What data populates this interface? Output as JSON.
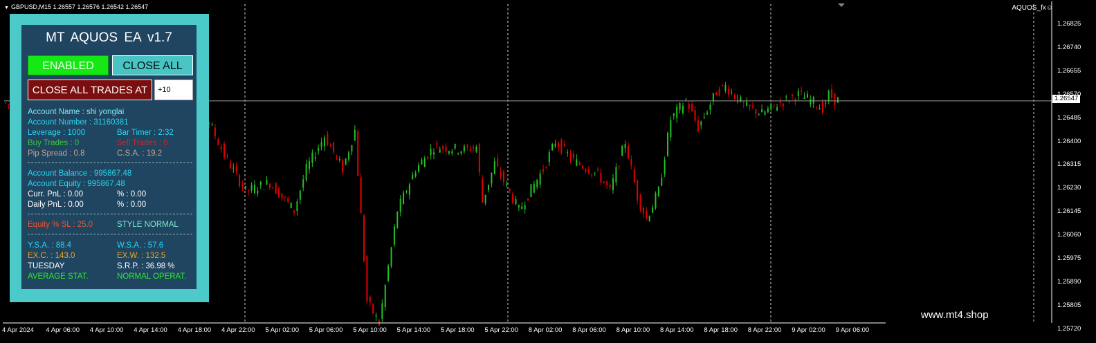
{
  "chart": {
    "symbol_header": "GBPUSD,M15  1.26557 1.26576 1.26542 1.26547",
    "indicator_label": "AQUOS_fx☺",
    "watermark": "www.mt4.shop",
    "current_price": "1.26547",
    "colors": {
      "bull": "#22c322",
      "bear": "#e60000",
      "grid": "#cfcfcf",
      "bid_line": "#9a9a9a"
    }
  },
  "axis": {
    "x_labels": [
      "4 Apr 2024",
      "4 Apr 06:00",
      "4 Apr 10:00",
      "4 Apr 14:00",
      "4 Apr 18:00",
      "4 Apr 22:00",
      "5 Apr 02:00",
      "5 Apr 06:00",
      "5 Apr 10:00",
      "5 Apr 14:00",
      "5 Apr 18:00",
      "5 Apr 22:00",
      "8 Apr 02:00",
      "8 Apr 06:00",
      "8 Apr 10:00",
      "8 Apr 14:00",
      "8 Apr 18:00",
      "8 Apr 22:00",
      "9 Apr 02:00",
      "9 Apr 06:00"
    ],
    "y_labels": [
      "1.26825",
      "1.26740",
      "1.26655",
      "1.26570",
      "1.26485",
      "1.26400",
      "1.26315",
      "1.26230",
      "1.26145",
      "1.26060",
      "1.25975",
      "1.25890",
      "1.25805",
      "1.25720"
    ]
  },
  "ea": {
    "title": "MT  AQUOS EA  v1.7",
    "enabled_label": "ENABLED",
    "close_all_label": "CLOSE ALL",
    "close_trades_at_label": "CLOSE ALL TRADES AT",
    "close_trades_value": "+10",
    "account_name": "Account Name : shi yonglai",
    "account_number": "Account Number : 31160381",
    "leverage": "Leverage : 1000",
    "bar_timer": "Bar Timer : 2:32",
    "buy_trades": "Buy Trades : 0",
    "sell_trades": "Sell Trades : 0",
    "pip_spread": "Pip Spread : 0.8",
    "csa": "C.S.A. : 19.2",
    "balance": "Account Balance : 995867.48",
    "equity": "Account Equity : 995867.48",
    "curr_pnl": "Curr. PnL : 0.00",
    "curr_pct": "% : 0.00",
    "daily_pnl": "Daily PnL : 0.00",
    "daily_pct": "% : 0.00",
    "equity_sl": "Equity % SL : 25.0",
    "style": "STYLE NORMAL",
    "ysa": "Y.S.A. : 88.4",
    "wsa": "W.S.A. : 57.6",
    "exc": "EX.C. : 143.0",
    "exw": "EX.W. : 132.5",
    "day": "TUESDAY",
    "srp": "S.R.P. : 36.98 %",
    "avg_stat": "AVERAGE STAT.",
    "normal_operat": "NORMAL OPERAT."
  },
  "chart_data": {
    "type": "candlestick",
    "symbol": "GBPUSD",
    "timeframe": "M15",
    "ylim": [
      1.2572,
      1.2688
    ],
    "bid": 1.26547,
    "anchors": [
      [
        0,
        1.2654
      ],
      [
        5,
        1.2652
      ],
      [
        30,
        1.2652
      ],
      [
        33,
        1.266
      ],
      [
        45,
        1.265
      ],
      [
        52,
        1.264
      ],
      [
        58,
        1.2645
      ],
      [
        63,
        1.265
      ],
      [
        68,
        1.2647
      ],
      [
        73,
        1.2635
      ],
      [
        80,
        1.2622
      ],
      [
        88,
        1.2625
      ],
      [
        96,
        1.2615
      ],
      [
        100,
        1.263
      ],
      [
        106,
        1.2642
      ],
      [
        112,
        1.263
      ],
      [
        116,
        1.2644
      ],
      [
        120,
        1.2582
      ],
      [
        124,
        1.2574
      ],
      [
        130,
        1.2615
      ],
      [
        136,
        1.263
      ],
      [
        142,
        1.2638
      ],
      [
        152,
        1.2637
      ],
      [
        156,
        1.2638
      ],
      [
        158,
        1.2618
      ],
      [
        162,
        1.2632
      ],
      [
        170,
        1.2615
      ],
      [
        178,
        1.263
      ],
      [
        182,
        1.264
      ],
      [
        188,
        1.2633
      ],
      [
        196,
        1.2628
      ],
      [
        200,
        1.2622
      ],
      [
        205,
        1.264
      ],
      [
        209,
        1.262
      ],
      [
        212,
        1.2612
      ],
      [
        216,
        1.2622
      ],
      [
        220,
        1.2648
      ],
      [
        225,
        1.2655
      ],
      [
        229,
        1.2645
      ],
      [
        235,
        1.2658
      ],
      [
        238,
        1.266
      ],
      [
        244,
        1.2653
      ],
      [
        250,
        1.265
      ],
      [
        256,
        1.2654
      ],
      [
        262,
        1.2657
      ],
      [
        266,
        1.2655
      ],
      [
        270,
        1.2652
      ],
      [
        272,
        1.2657
      ],
      [
        274,
        1.2655
      ]
    ]
  }
}
